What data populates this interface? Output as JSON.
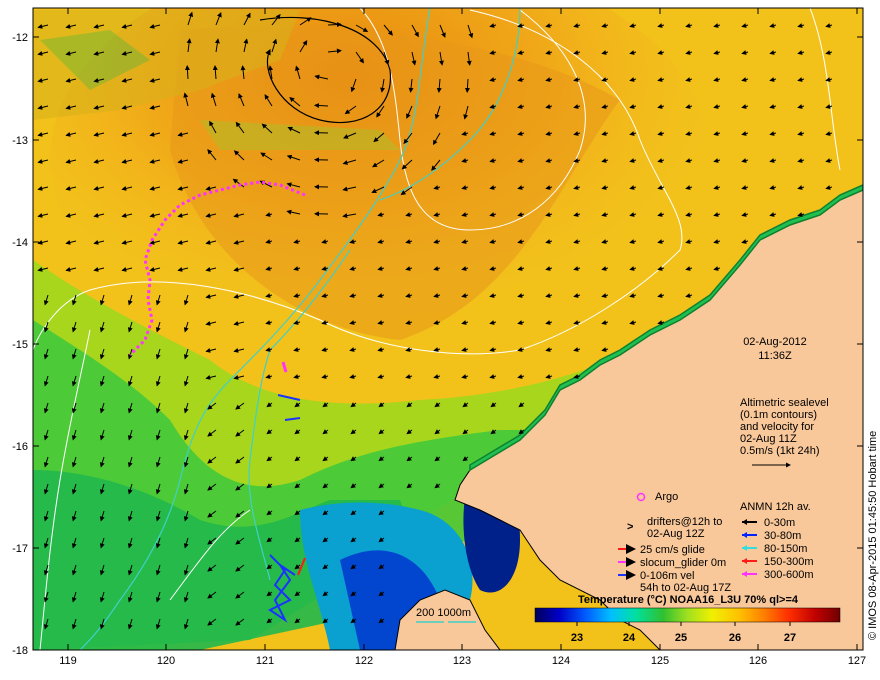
{
  "map": {
    "date": "02-Aug-2012",
    "time": "11:36Z",
    "lon_ticks": [
      "119",
      "120",
      "121",
      "122",
      "123",
      "124",
      "125",
      "126",
      "127"
    ],
    "lat_ticks": [
      "-12",
      "-13",
      "-14",
      "-15",
      "-16",
      "-17",
      "-18"
    ],
    "altimetry_text": [
      "Altimetric sealevel",
      "(0.1m contours)",
      "and velocity for",
      "02-Aug 11Z",
      "0.5m/s (1kt 24h)"
    ],
    "argo_label": "Argo",
    "drifters_label": [
      "drifters@12h to",
      "02-Aug 12Z"
    ],
    "glider_entries": [
      {
        "label": "25 cm/s glide",
        "color": "#ff1a1a"
      },
      {
        "label": "slocum_glider 0m",
        "color": "#ff33ff"
      },
      {
        "label": "0-106m vel",
        "color": "#1a33ff"
      },
      {
        "label": "54h to 02-Aug 17Z",
        "color": ""
      }
    ],
    "anmn_title": "ANMN 12h av.",
    "anmn_entries": [
      {
        "label": "0-30m",
        "color": "#000000"
      },
      {
        "label": "30-80m",
        "color": "#0022ff"
      },
      {
        "label": "80-150m",
        "color": "#33dddd"
      },
      {
        "label": "150-300m",
        "color": "#ff1a1a"
      },
      {
        "label": "300-600m",
        "color": "#ff33ff"
      }
    ],
    "depth_label": "200  1000m",
    "colorbar": {
      "title": "Temperature (°C) NOAA16_L3U 70% ql>=4",
      "ticks": [
        "23",
        "24",
        "25",
        "26",
        "27"
      ],
      "colors": [
        "#00005a",
        "#0000c8",
        "#0060ff",
        "#00c0ff",
        "#00e0a0",
        "#30c030",
        "#a0e020",
        "#f0f000",
        "#ffc000",
        "#ff8000",
        "#ff3000",
        "#c00000",
        "#700000"
      ]
    },
    "credit": "© IMOS 08-Apr-2015 01:45:50 Hobart time",
    "colors": {
      "land": "#f9c89a",
      "coast": "#000000",
      "contour": "#ffffff",
      "isobath": "#40d0c8",
      "warm": "#e89a10",
      "cool": "#18c048"
    }
  }
}
